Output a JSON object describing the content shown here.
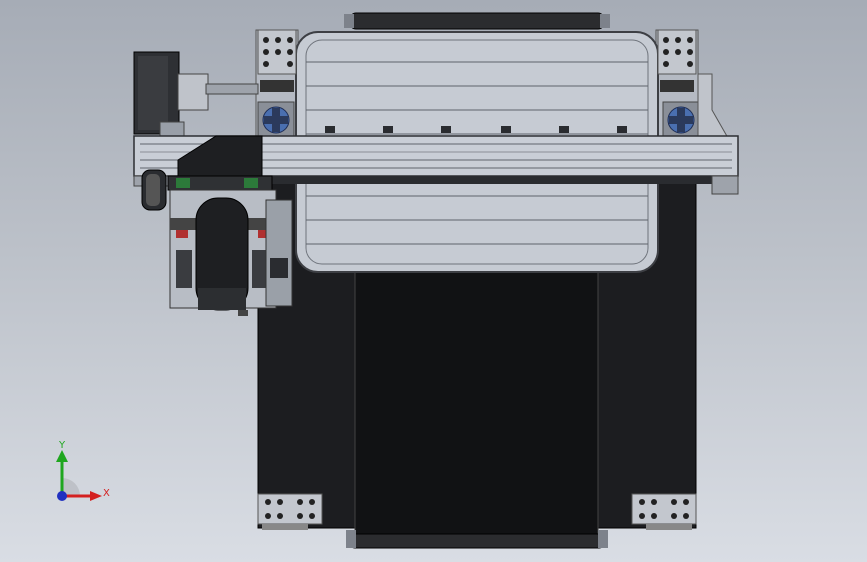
{
  "viewport": {
    "background_top": "#a6acb6",
    "background_bottom": "#d9dde4"
  },
  "triad": {
    "x_label": "X",
    "y_label": "Y",
    "x_color": "#d42020",
    "y_color": "#1fa61f",
    "z_color": "#2030c0"
  },
  "model": {
    "frame_color": "#1e1f22",
    "profile_color": "#c9ced6",
    "bolt_color": "#4a6fb0",
    "plate_color": "#b6bbc4"
  }
}
